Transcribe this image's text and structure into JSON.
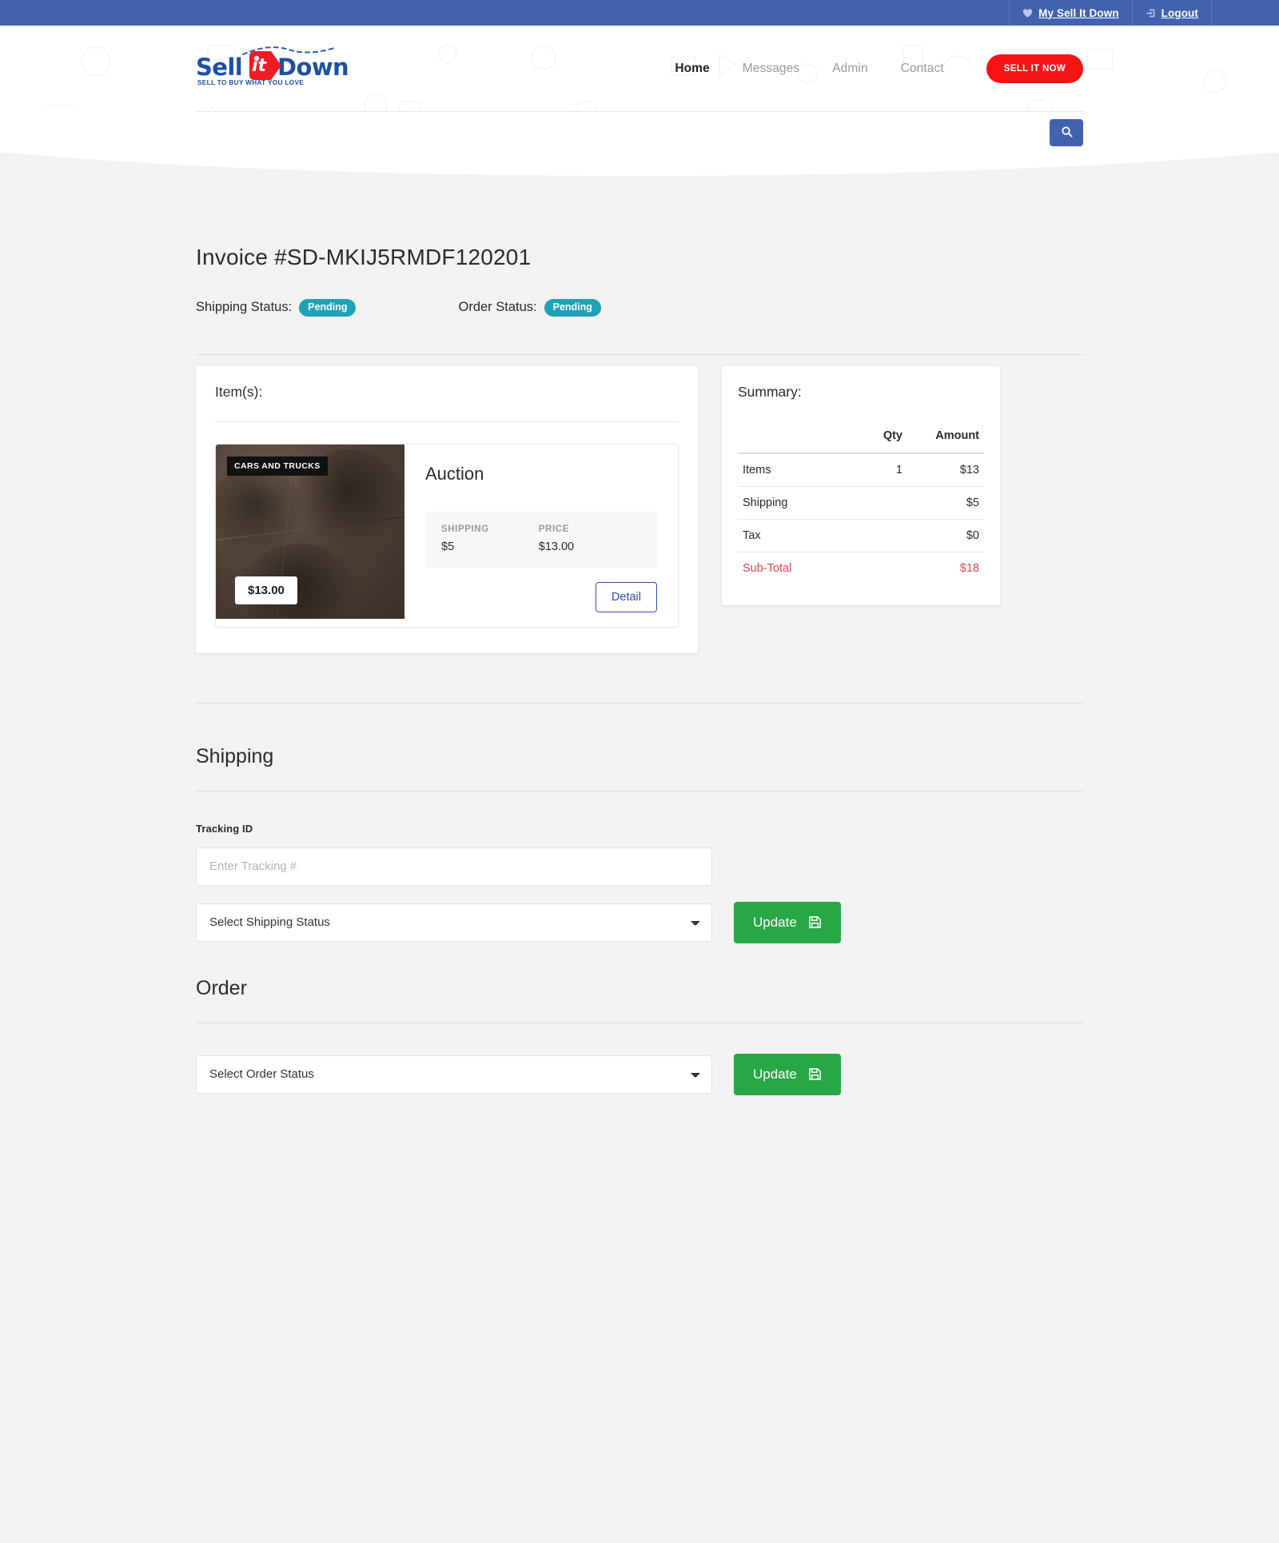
{
  "topbar": {
    "items": [
      {
        "label": "My Sell It Down",
        "icon": "heart-icon"
      },
      {
        "label": "Logout",
        "icon": "logout-icon"
      }
    ]
  },
  "header": {
    "logo": {
      "text_before": "Sell",
      "text_tag": "it",
      "text_after": "Down",
      "tagline": "SELL TO BUY WHAT YOU LOVE"
    },
    "nav": [
      {
        "label": "Home",
        "active": true
      },
      {
        "label": "Messages",
        "active": false
      },
      {
        "label": "Admin",
        "active": false
      },
      {
        "label": "Contact",
        "active": false
      }
    ],
    "cta_label": "SELL IT NOW",
    "search": {
      "placeholder": "",
      "value": "",
      "icon": "search-icon"
    }
  },
  "invoice": {
    "title": "Invoice #SD-MKIJ5RMDF120201",
    "shipping_status_label": "Shipping Status:",
    "shipping_status_value": "Pending",
    "order_status_label": "Order Status:",
    "order_status_value": "Pending",
    "badge_color": "#1fa2b8"
  },
  "items_card": {
    "title": "Item(s):",
    "items": [
      {
        "category": "CARS AND TRUCKS",
        "photo_price": "$13.00",
        "name": "Auction",
        "shipping_label": "SHIPPING",
        "shipping_value": "$5",
        "price_label": "PRICE",
        "price_value": "$13.00",
        "detail_label": "Detail"
      }
    ]
  },
  "summary_card": {
    "title": "Summary:",
    "columns": [
      "",
      "Qty",
      "Amount"
    ],
    "rows": [
      {
        "label": "Items",
        "qty": "1",
        "amount": "$13"
      },
      {
        "label": "Shipping",
        "qty": "",
        "amount": "$5"
      },
      {
        "label": "Tax",
        "qty": "",
        "amount": "$0"
      },
      {
        "label": "Sub-Total",
        "qty": "",
        "amount": "$18"
      }
    ],
    "total_color": "#e8415a"
  },
  "shipping_section": {
    "heading": "Shipping",
    "tracking_label": "Tracking ID",
    "tracking_placeholder": "Enter Tracking #",
    "tracking_value": "",
    "status_select_value": "Select Shipping Status",
    "update_label": "Update"
  },
  "order_section": {
    "heading": "Order",
    "status_select_value": "Select Order Status",
    "update_label": "Update"
  }
}
